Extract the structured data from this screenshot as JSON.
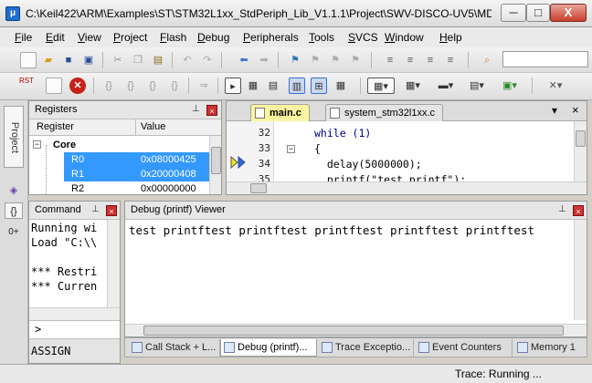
{
  "window": {
    "title": "C:\\Keil422\\ARM\\Examples\\ST\\STM32L1xx_StdPeriph_Lib_V1.1.1\\Project\\SWV-DISCO-UV5\\MD...",
    "min_glyph": "─",
    "max_glyph": "□",
    "close_glyph": "X"
  },
  "menu": [
    "File",
    "Edit",
    "View",
    "Project",
    "Flash",
    "Debug",
    "Peripherals",
    "Tools",
    "SVCS",
    "Window",
    "Help"
  ],
  "toolbar": {
    "reset_label": "RST",
    "brace_icons": [
      "{}",
      "{}",
      "{}",
      "{}"
    ]
  },
  "sidebar": {
    "project_tab": "Project",
    "icons": [
      "books-icon",
      "braces-icon",
      "function-icon"
    ],
    "braces_glyph": "{}",
    "function_glyph": "0+"
  },
  "registers": {
    "title": "Registers",
    "pin_glyph": "ᵩ",
    "col_register": "Register",
    "col_value": "Value",
    "group": "Core",
    "rows": [
      {
        "name": "R0",
        "value": "0x08000425",
        "selected": true
      },
      {
        "name": "R1",
        "value": "0x20000408",
        "selected": true
      },
      {
        "name": "R2",
        "value": "0x00000000",
        "selected": false
      }
    ]
  },
  "editor": {
    "tabs": [
      {
        "label": "main.c",
        "active": true
      },
      {
        "label": "system_stm32l1xx.c",
        "active": false
      }
    ],
    "lines": [
      {
        "num": "32",
        "text": "while (1)"
      },
      {
        "num": "33",
        "text": "{"
      },
      {
        "num": "34",
        "text": "  delay(5000000);"
      },
      {
        "num": "35",
        "text": "  printf(\"test printf\");"
      }
    ],
    "menu_glyph": "▾",
    "close_glyph": "×"
  },
  "command": {
    "title": "Command",
    "lines": [
      "Running wi",
      "Load \"C:\\\\",
      "",
      "*** Restri",
      "*** Curren"
    ],
    "prompt": ">",
    "autocomplete": "ASSIGN"
  },
  "debug_printf": {
    "title": "Debug (printf) Viewer",
    "output": "test printftest printftest printftest printftest printftest"
  },
  "bottom_tabs": [
    {
      "label": "Call Stack + L...",
      "active": false
    },
    {
      "label": "Debug (printf)...",
      "active": true
    },
    {
      "label": "Trace Exceptio...",
      "active": false
    },
    {
      "label": "Event Counters",
      "active": false
    },
    {
      "label": "Memory 1",
      "active": false
    }
  ],
  "status": {
    "text": "Trace: Running ..."
  },
  "colors": {
    "selection": "#3399ff",
    "active_tab": "#fdf4a0",
    "close_red": "#c33"
  }
}
